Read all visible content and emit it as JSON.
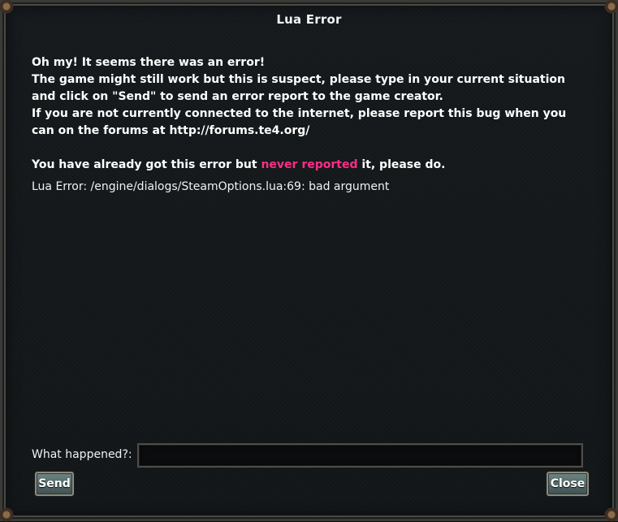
{
  "dialog": {
    "title": "Lua Error"
  },
  "message": {
    "line1": "Oh my! It seems there was an error!",
    "line2": "The game might still work but this is suspect, please type in your current situation",
    "line3": "and click on \"Send\" to send an error report to the game creator.",
    "line4": "If you are not currently connected to the internet, please report this bug when you",
    "line5": "can on the forums at http://forums.te4.org/",
    "already_prefix": "You have already got this error but ",
    "already_highlight": "never reported",
    "already_suffix": " it, please do.",
    "highlight_color": "#ff2d88"
  },
  "error": {
    "text": "Lua Error: /engine/dialogs/SteamOptions.lua:69: bad argument"
  },
  "report": {
    "label": "What happened?:",
    "value": "",
    "placeholder": ""
  },
  "buttons": {
    "send": "Send",
    "close": "Close"
  }
}
